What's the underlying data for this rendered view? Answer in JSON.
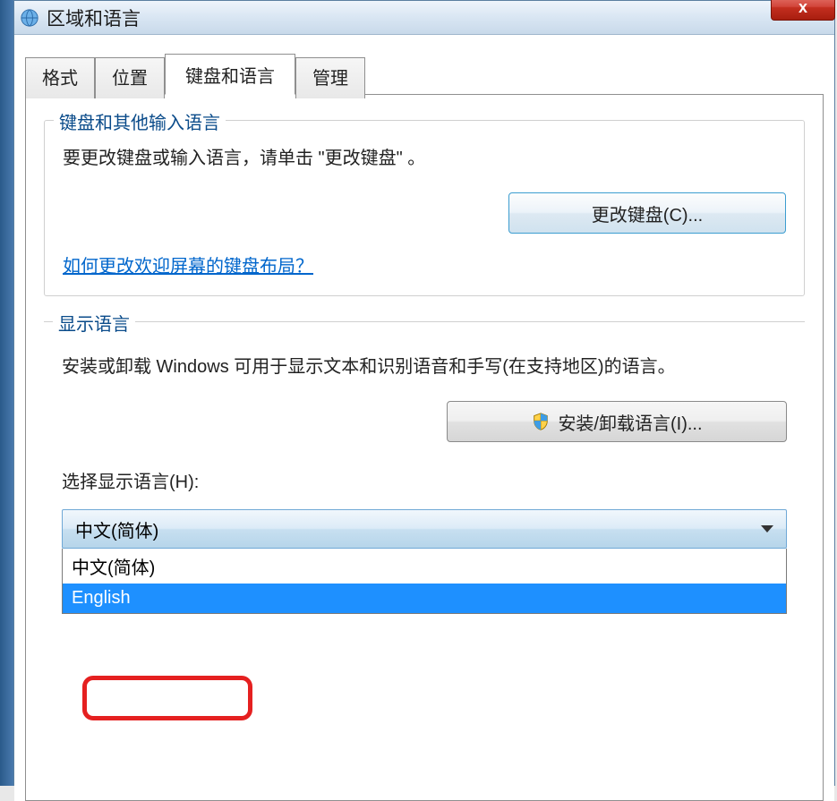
{
  "window": {
    "title": "区域和语言",
    "close_label": "x"
  },
  "tabs": [
    {
      "label": "格式"
    },
    {
      "label": "位置"
    },
    {
      "label": "键盘和语言"
    },
    {
      "label": "管理"
    }
  ],
  "keyboard_group": {
    "title": "键盘和其他输入语言",
    "description": "要更改键盘或输入语言，请单击 \"更改键盘\" 。",
    "change_button": "更改键盘(C)...",
    "link_text": "如何更改欢迎屏幕的键盘布局？"
  },
  "display_group": {
    "title": "显示语言",
    "description": "安装或卸载 Windows 可用于显示文本和识别语音和手写(在支持地区)的语言。",
    "install_button": "安装/卸载语言(I)...",
    "select_label": "选择显示语言(H):",
    "selected_value": "中文(简体)",
    "options": [
      "中文(简体)",
      "English"
    ]
  }
}
